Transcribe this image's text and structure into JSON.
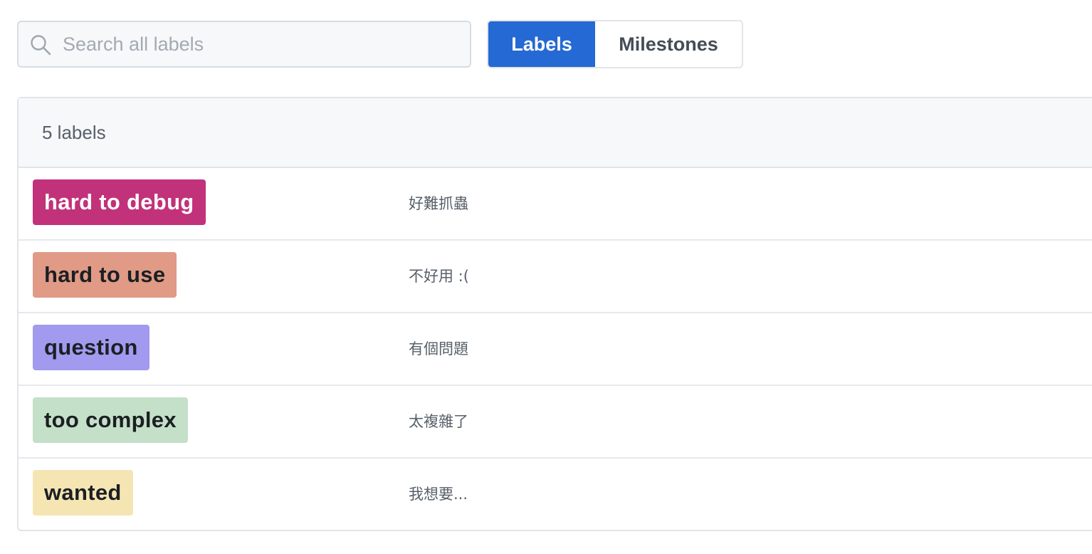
{
  "search": {
    "placeholder": "Search all labels",
    "value": ""
  },
  "tabs": [
    {
      "label": "Labels",
      "selected": true
    },
    {
      "label": "Milestones",
      "selected": false
    }
  ],
  "labels_header": {
    "count_text": "5 labels"
  },
  "labels": [
    {
      "name": "hard to debug",
      "description": "好難抓蟲",
      "color": "#c1327a",
      "text_color": "#ffffff"
    },
    {
      "name": "hard to use",
      "description": "不好用 :(",
      "color": "#e09a85",
      "text_color": "#1b1f23"
    },
    {
      "name": "question",
      "description": "有個問題",
      "color": "#a29aee",
      "text_color": "#1b1f23"
    },
    {
      "name": "too complex",
      "description": "太複雜了",
      "color": "#c4e0c8",
      "text_color": "#1b1f23"
    },
    {
      "name": "wanted",
      "description": "我想要...",
      "color": "#f5e5b3",
      "text_color": "#1b1f23"
    }
  ],
  "icons": {
    "search": "search-icon"
  },
  "colors": {
    "accent": "#2469d4",
    "header_bg": "#f6f8fa",
    "border": "#e1e4e8"
  }
}
